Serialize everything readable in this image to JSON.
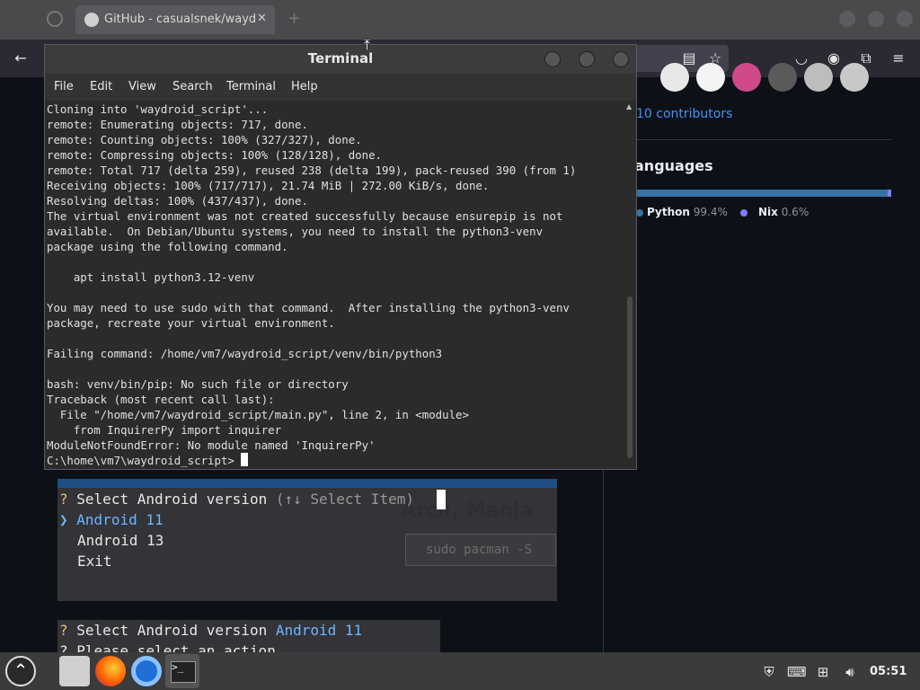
{
  "browser": {
    "tab_title": "GitHub - casualsnek/waydroid_script",
    "tab_close": "✕"
  },
  "github": {
    "contributors": "10 contributors",
    "languages_heading": "anguages",
    "languages": [
      {
        "name": "Python",
        "percent": "99.4%",
        "color": "#3572A5"
      },
      {
        "name": "Nix",
        "percent": "0.6%",
        "color": "#7e7eff"
      }
    ]
  },
  "bg_terminal": {
    "prompt1_mark": "?",
    "prompt1_text": "Select Android version",
    "prompt1_hint": "(↑↓ Select Item)",
    "selector": "❯",
    "option1": "Android 11",
    "option2": "Android 13",
    "option3": "Exit",
    "ghost_command": "sudo pacman -S",
    "prompt2_mark": "?",
    "prompt2_text": "Select Android version",
    "prompt2_answer": "Android 11",
    "prompt3_text": "? Please select an action"
  },
  "terminal": {
    "title": "Terminal",
    "menu": [
      "File",
      "Edit",
      "View",
      "Search",
      "Terminal",
      "Help"
    ],
    "output": "Cloning into 'waydroid_script'...\nremote: Enumerating objects: 717, done.\nremote: Counting objects: 100% (327/327), done.\nremote: Compressing objects: 100% (128/128), done.\nremote: Total 717 (delta 259), reused 238 (delta 199), pack-reused 390 (from 1)\nReceiving objects: 100% (717/717), 21.74 MiB | 272.00 KiB/s, done.\nResolving deltas: 100% (437/437), done.\nThe virtual environment was not created successfully because ensurepip is not\navailable.  On Debian/Ubuntu systems, you need to install the python3-venv\npackage using the following command.\n\n    apt install python3.12-venv\n\nYou may need to use sudo with that command.  After installing the python3-venv\npackage, recreate your virtual environment.\n\nFailing command: /home/vm7/waydroid_script/venv/bin/python3\n\nbash: venv/bin/pip: No such file or directory\nTraceback (most recent call last):\n  File \"/home/vm7/waydroid_script/main.py\", line 2, in <module>\n    from InquirerPy import inquirer\nModuleNotFoundError: No module named 'InquirerPy'",
    "prompt": "C:\\home\\vm7\\waydroid_script> "
  },
  "taskbar": {
    "clock": "05:51",
    "apps": [
      "menu-logo",
      "file-manager-icon",
      "firefox-icon",
      "chromium-icon",
      "terminal-icon"
    ]
  },
  "colors": {
    "accent_blue": "#4493f8",
    "python_lang": "#3572A5",
    "selected_option": "#6cb6ff"
  }
}
